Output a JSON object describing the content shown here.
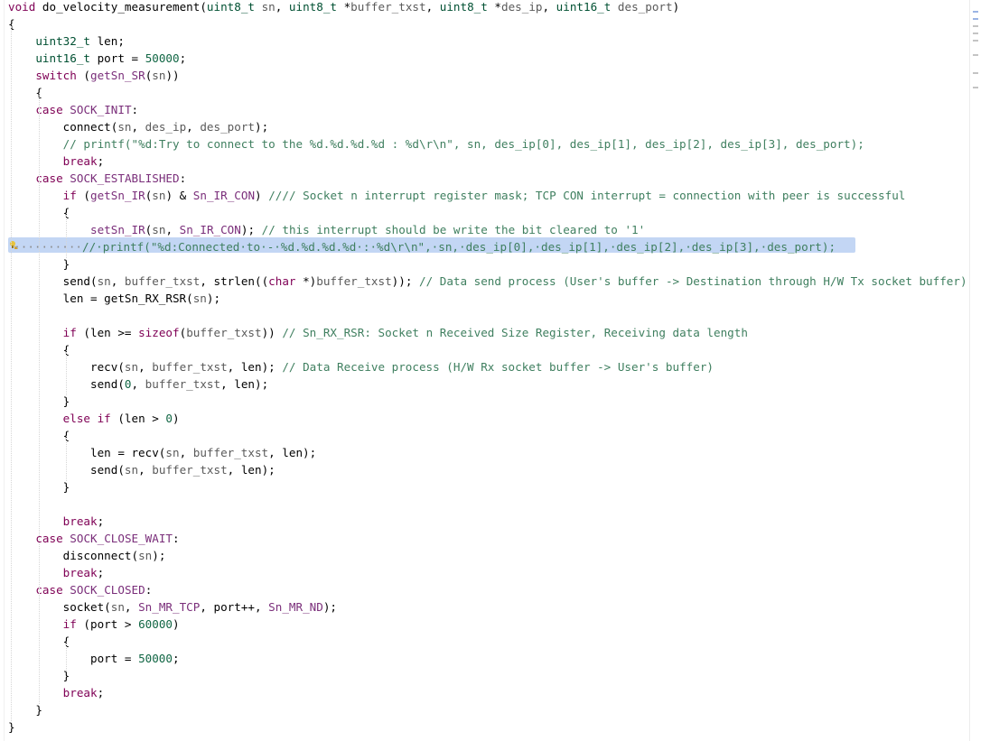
{
  "editor": {
    "lines": [
      {
        "segments": [
          [
            "kw",
            "void"
          ],
          [
            "fn",
            " do_velocity_measurement("
          ],
          [
            "ty",
            "uint8_t"
          ],
          [
            "pm",
            " sn"
          ],
          [
            "fn",
            ", "
          ],
          [
            "ty",
            "uint8_t"
          ],
          [
            "fn",
            " *"
          ],
          [
            "pm",
            "buffer_txst"
          ],
          [
            "fn",
            ", "
          ],
          [
            "ty",
            "uint8_t"
          ],
          [
            "fn",
            " *"
          ],
          [
            "pm",
            "des_ip"
          ],
          [
            "fn",
            ", "
          ],
          [
            "ty",
            "uint16_t"
          ],
          [
            "pm",
            " des_port"
          ],
          [
            "fn",
            ")"
          ]
        ]
      },
      {
        "segments": [
          [
            "fn",
            "{"
          ]
        ]
      },
      {
        "segments": [
          [
            "fn",
            "    "
          ],
          [
            "ty",
            "uint32_t"
          ],
          [
            "fn",
            " len;"
          ]
        ]
      },
      {
        "segments": [
          [
            "fn",
            "    "
          ],
          [
            "ty",
            "uint16_t"
          ],
          [
            "fn",
            " port = "
          ],
          [
            "num",
            "50000"
          ],
          [
            "fn",
            ";"
          ]
        ]
      },
      {
        "segments": [
          [
            "fn",
            "    "
          ],
          [
            "kw",
            "switch"
          ],
          [
            "fn",
            " ("
          ],
          [
            "mc",
            "getSn_SR"
          ],
          [
            "fn",
            "("
          ],
          [
            "pm",
            "sn"
          ],
          [
            "fn",
            "))"
          ]
        ]
      },
      {
        "segments": [
          [
            "fn",
            "    {"
          ]
        ]
      },
      {
        "segments": [
          [
            "fn",
            "    "
          ],
          [
            "kw",
            "case"
          ],
          [
            "fn",
            " "
          ],
          [
            "mc",
            "SOCK_INIT"
          ],
          [
            "fn",
            ":"
          ]
        ]
      },
      {
        "segments": [
          [
            "fn",
            "        connect("
          ],
          [
            "pm",
            "sn"
          ],
          [
            "fn",
            ", "
          ],
          [
            "pm",
            "des_ip"
          ],
          [
            "fn",
            ", "
          ],
          [
            "pm",
            "des_port"
          ],
          [
            "fn",
            ");"
          ]
        ]
      },
      {
        "segments": [
          [
            "fn",
            "        "
          ],
          [
            "cm",
            "// printf(\"%d:Try to connect to the %d.%d.%d.%d : %d\\r\\n\", sn, des_ip[0], des_ip[1], des_ip[2], des_ip[3], des_port);"
          ]
        ]
      },
      {
        "segments": [
          [
            "fn",
            "        "
          ],
          [
            "kw",
            "break"
          ],
          [
            "fn",
            ";"
          ]
        ]
      },
      {
        "segments": [
          [
            "fn",
            "    "
          ],
          [
            "kw",
            "case"
          ],
          [
            "fn",
            " "
          ],
          [
            "mc",
            "SOCK_ESTABLISHED"
          ],
          [
            "fn",
            ":"
          ]
        ]
      },
      {
        "segments": [
          [
            "fn",
            "        "
          ],
          [
            "kw",
            "if"
          ],
          [
            "fn",
            " ("
          ],
          [
            "mc",
            "getSn_IR"
          ],
          [
            "fn",
            "("
          ],
          [
            "pm",
            "sn"
          ],
          [
            "fn",
            ") & "
          ],
          [
            "mc",
            "Sn_IR_CON"
          ],
          [
            "fn",
            ") "
          ],
          [
            "cm",
            "//// Socket n interrupt register mask; TCP CON interrupt = connection with peer is successful"
          ]
        ]
      },
      {
        "segments": [
          [
            "fn",
            "        {"
          ]
        ]
      },
      {
        "segments": [
          [
            "fn",
            "            "
          ],
          [
            "mc",
            "setSn_IR"
          ],
          [
            "fn",
            "("
          ],
          [
            "pm",
            "sn"
          ],
          [
            "fn",
            ", "
          ],
          [
            "mc",
            "Sn_IR_CON"
          ],
          [
            "fn",
            "); "
          ],
          [
            "cm",
            "// this interrupt should be write the bit cleared to '1'"
          ]
        ]
      },
      {
        "segments": [
          [
            "mu",
            "  ··········"
          ],
          [
            "cm",
            "//·printf(\"%d:Connected·to·-·%d.%d.%d.%d·:·%d\\r\\n\",·sn,·des_ip[0],·des_ip[1],·des_ip[2],·des_ip[3],·des_port);"
          ]
        ]
      },
      {
        "segments": [
          [
            "fn",
            "        }"
          ]
        ]
      },
      {
        "segments": [
          [
            "fn",
            "        send("
          ],
          [
            "pm",
            "sn"
          ],
          [
            "fn",
            ", "
          ],
          [
            "pm",
            "buffer_txst"
          ],
          [
            "fn",
            ", strlen(("
          ],
          [
            "kw",
            "char"
          ],
          [
            "fn",
            " *)"
          ],
          [
            "pm",
            "buffer_txst"
          ],
          [
            "fn",
            "));"
          ],
          [
            "cm",
            " // Data send process (User's buffer -> Destination through H/W Tx socket buffer)"
          ]
        ]
      },
      {
        "segments": [
          [
            "fn",
            "        len = getSn_RX_RSR("
          ],
          [
            "pm",
            "sn"
          ],
          [
            "fn",
            ");"
          ]
        ]
      },
      {
        "segments": [
          [
            "fn",
            ""
          ]
        ]
      },
      {
        "segments": [
          [
            "fn",
            "        "
          ],
          [
            "kw",
            "if"
          ],
          [
            "fn",
            " (len >= "
          ],
          [
            "kw",
            "sizeof"
          ],
          [
            "fn",
            "("
          ],
          [
            "pm",
            "buffer_txst"
          ],
          [
            "fn",
            ")) "
          ],
          [
            "cm",
            "// Sn_RX_RSR: Socket n Received Size Register, Receiving data length"
          ]
        ]
      },
      {
        "segments": [
          [
            "fn",
            "        {"
          ]
        ]
      },
      {
        "segments": [
          [
            "fn",
            "            recv("
          ],
          [
            "pm",
            "sn"
          ],
          [
            "fn",
            ", "
          ],
          [
            "pm",
            "buffer_txst"
          ],
          [
            "fn",
            ", len); "
          ],
          [
            "cm",
            "// Data Receive process (H/W Rx socket buffer -> User's buffer)"
          ]
        ]
      },
      {
        "segments": [
          [
            "fn",
            "            send("
          ],
          [
            "num",
            "0"
          ],
          [
            "fn",
            ", "
          ],
          [
            "pm",
            "buffer_txst"
          ],
          [
            "fn",
            ", len);"
          ]
        ]
      },
      {
        "segments": [
          [
            "fn",
            "        }"
          ]
        ]
      },
      {
        "segments": [
          [
            "fn",
            "        "
          ],
          [
            "kw",
            "else if"
          ],
          [
            "fn",
            " (len > "
          ],
          [
            "num",
            "0"
          ],
          [
            "fn",
            ")"
          ]
        ]
      },
      {
        "segments": [
          [
            "fn",
            "        {"
          ]
        ]
      },
      {
        "segments": [
          [
            "fn",
            "            len = recv("
          ],
          [
            "pm",
            "sn"
          ],
          [
            "fn",
            ", "
          ],
          [
            "pm",
            "buffer_txst"
          ],
          [
            "fn",
            ", len);"
          ]
        ]
      },
      {
        "segments": [
          [
            "fn",
            "            send("
          ],
          [
            "pm",
            "sn"
          ],
          [
            "fn",
            ", "
          ],
          [
            "pm",
            "buffer_txst"
          ],
          [
            "fn",
            ", len);"
          ]
        ]
      },
      {
        "segments": [
          [
            "fn",
            "        }"
          ]
        ]
      },
      {
        "segments": [
          [
            "fn",
            ""
          ]
        ]
      },
      {
        "segments": [
          [
            "fn",
            "        "
          ],
          [
            "kw",
            "break"
          ],
          [
            "fn",
            ";"
          ]
        ]
      },
      {
        "segments": [
          [
            "fn",
            "    "
          ],
          [
            "kw",
            "case"
          ],
          [
            "fn",
            " "
          ],
          [
            "mc",
            "SOCK_CLOSE_WAIT"
          ],
          [
            "fn",
            ":"
          ]
        ]
      },
      {
        "segments": [
          [
            "fn",
            "        disconnect("
          ],
          [
            "pm",
            "sn"
          ],
          [
            "fn",
            ");"
          ]
        ]
      },
      {
        "segments": [
          [
            "fn",
            "        "
          ],
          [
            "kw",
            "break"
          ],
          [
            "fn",
            ";"
          ]
        ]
      },
      {
        "segments": [
          [
            "fn",
            "    "
          ],
          [
            "kw",
            "case"
          ],
          [
            "fn",
            " "
          ],
          [
            "mc",
            "SOCK_CLOSED"
          ],
          [
            "fn",
            ":"
          ]
        ]
      },
      {
        "segments": [
          [
            "fn",
            "        socket("
          ],
          [
            "pm",
            "sn"
          ],
          [
            "fn",
            ", "
          ],
          [
            "mc",
            "Sn_MR_TCP"
          ],
          [
            "fn",
            ", port++, "
          ],
          [
            "mc",
            "Sn_MR_ND"
          ],
          [
            "fn",
            ");"
          ]
        ]
      },
      {
        "segments": [
          [
            "fn",
            "        "
          ],
          [
            "kw",
            "if"
          ],
          [
            "fn",
            " (port > "
          ],
          [
            "num",
            "60000"
          ],
          [
            "fn",
            ")"
          ]
        ]
      },
      {
        "segments": [
          [
            "fn",
            "        {"
          ]
        ]
      },
      {
        "segments": [
          [
            "fn",
            "            port = "
          ],
          [
            "num",
            "50000"
          ],
          [
            "fn",
            ";"
          ]
        ]
      },
      {
        "segments": [
          [
            "fn",
            "        }"
          ]
        ]
      },
      {
        "segments": [
          [
            "fn",
            "        "
          ],
          [
            "kw",
            "break"
          ],
          [
            "fn",
            ";"
          ]
        ]
      },
      {
        "segments": [
          [
            "fn",
            "    }"
          ]
        ]
      },
      {
        "segments": [
          [
            "fn",
            "}"
          ]
        ]
      }
    ],
    "highlighted_line": 14,
    "marker_icon": "lightbulb-warning-icon"
  },
  "colors": {
    "selection": "#c3d6f4",
    "keyword": "#7f0055",
    "comment": "#3f7f5f",
    "macro": "#7a2e7a"
  }
}
